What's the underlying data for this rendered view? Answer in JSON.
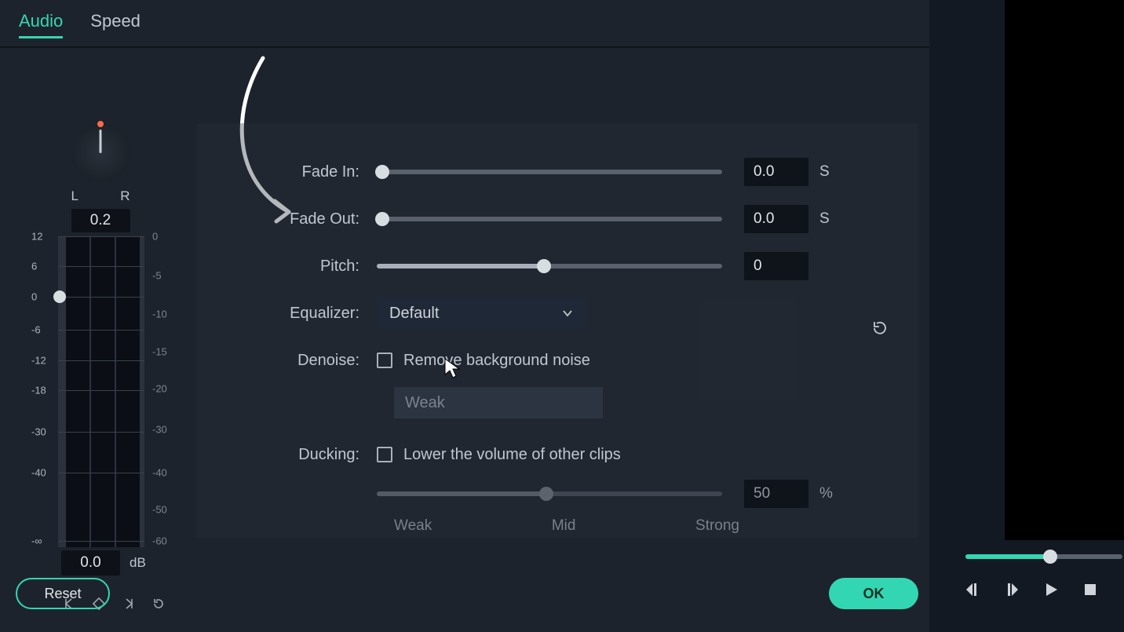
{
  "tabs": {
    "audio": "Audio",
    "speed": "Speed",
    "active": "audio"
  },
  "pan": {
    "L": "L",
    "R": "R",
    "value": "0.2"
  },
  "meter_ticks_left": [
    "12",
    "6",
    "0",
    "-6",
    "-12",
    "-18",
    "-30",
    "-40",
    "-∞"
  ],
  "meter_ticks_right": [
    "0",
    "-5",
    "-10",
    "-15",
    "-20",
    "-30",
    "-40",
    "-50",
    "-60"
  ],
  "volume": {
    "value": "0.0",
    "unit": "dB"
  },
  "fadein": {
    "label": "Fade In:",
    "value": "0.0",
    "unit": "S",
    "pct": 0
  },
  "fadeout": {
    "label": "Fade Out:",
    "value": "0.0",
    "unit": "S",
    "pct": 0
  },
  "pitch": {
    "label": "Pitch:",
    "value": "0",
    "pct": 48.5
  },
  "equalizer": {
    "label": "Equalizer:",
    "value": "Default"
  },
  "denoise": {
    "label": "Denoise:",
    "text": "Remove background noise",
    "level": "Weak"
  },
  "ducking": {
    "label": "Ducking:",
    "text": "Lower the volume of other clips",
    "value": "50",
    "unit": "%",
    "pct": 49,
    "marks": {
      "weak": "Weak",
      "mid": "Mid",
      "strong": "Strong"
    }
  },
  "buttons": {
    "reset": "Reset",
    "ok": "OK"
  }
}
